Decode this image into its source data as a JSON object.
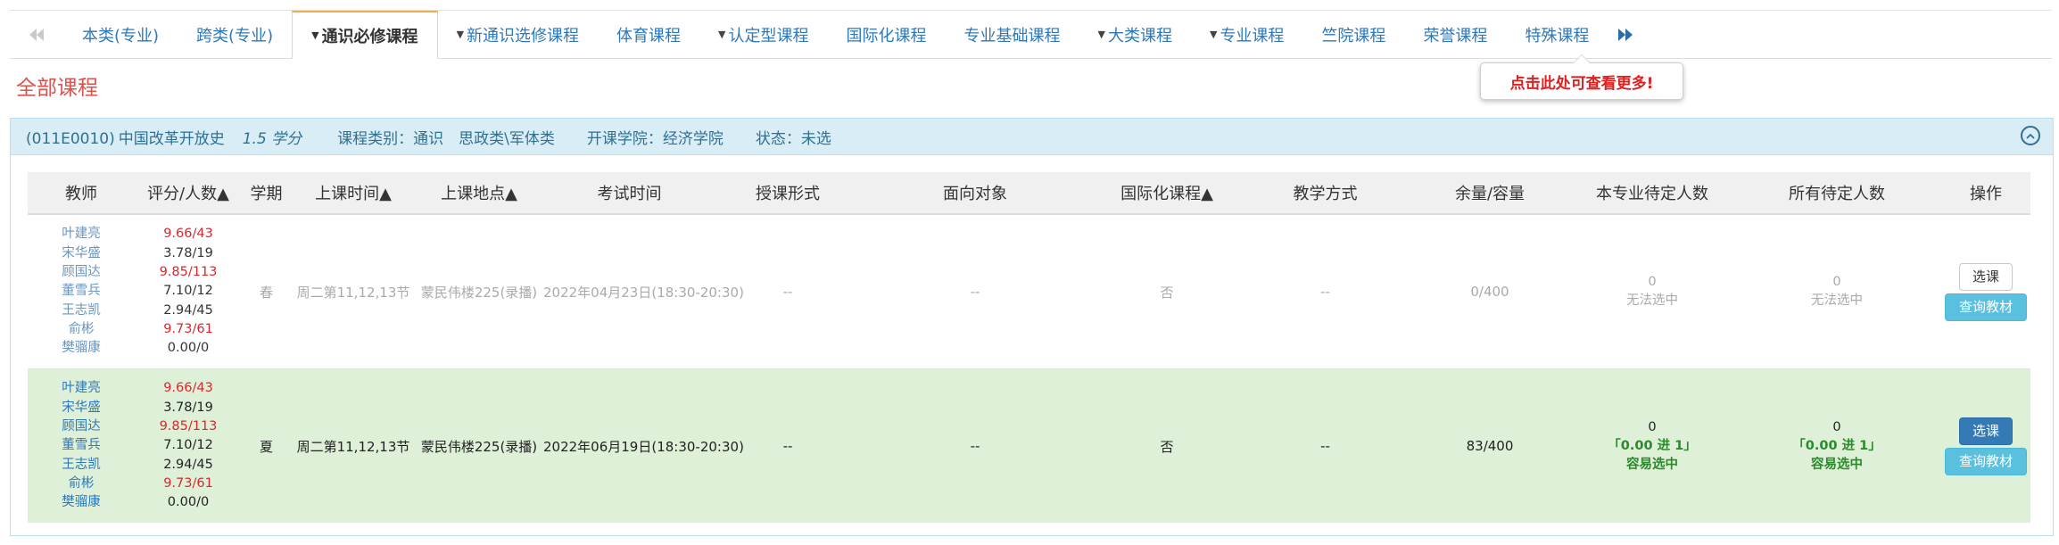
{
  "tabs": [
    {
      "label": "本类(专业)",
      "caret": false,
      "active": false
    },
    {
      "label": "跨类(专业)",
      "caret": false,
      "active": false
    },
    {
      "label": "通识必修课程",
      "caret": true,
      "active": true
    },
    {
      "label": "新通识选修课程",
      "caret": true,
      "active": false
    },
    {
      "label": "体育课程",
      "caret": false,
      "active": false
    },
    {
      "label": "认定型课程",
      "caret": true,
      "active": false
    },
    {
      "label": "国际化课程",
      "caret": false,
      "active": false
    },
    {
      "label": "专业基础课程",
      "caret": false,
      "active": false
    },
    {
      "label": "大类课程",
      "caret": true,
      "active": false
    },
    {
      "label": "专业课程",
      "caret": true,
      "active": false
    },
    {
      "label": "竺院课程",
      "caret": false,
      "active": false
    },
    {
      "label": "荣誉课程",
      "caret": false,
      "active": false
    },
    {
      "label": "特殊课程",
      "caret": false,
      "active": false
    }
  ],
  "tooltip": "点击此处可查看更多!",
  "section_title": "全部课程",
  "course": {
    "code": "(011E0010)",
    "name": "中国改革开放史",
    "credit": "1.5 学分",
    "category": "课程类别：通识　思政类\\军体类",
    "college": "开课学院：经济学院",
    "status": "状态：未选"
  },
  "columns": [
    "教师",
    "评分/人数▲",
    "学期",
    "上课时间▲",
    "上课地点▲",
    "考试时间",
    "授课形式",
    "面向对象",
    "国际化课程▲",
    "教学方式",
    "余量/容量",
    "本专业待定人数",
    "所有待定人数",
    "操作"
  ],
  "rows": [
    {
      "teachers": [
        "叶建亮",
        "宋华盛",
        "顾国达",
        "董雪兵",
        "王志凯",
        "俞彬",
        "樊骝康"
      ],
      "ratings": [
        {
          "v": "9.66/43",
          "hi": true
        },
        {
          "v": "3.78/19",
          "hi": false
        },
        {
          "v": "9.85/113",
          "hi": true
        },
        {
          "v": "7.10/12",
          "hi": false
        },
        {
          "v": "2.94/45",
          "hi": false
        },
        {
          "v": "9.73/61",
          "hi": true
        },
        {
          "v": "0.00/0",
          "hi": false
        }
      ],
      "term": "春",
      "time": "周二第11,12,13节",
      "place": "蒙民伟楼225(录播)",
      "exam": "2022年04月23日(18:30-20:30)",
      "form": "--",
      "audience": "--",
      "intl": "否",
      "method": "--",
      "capacity": "0/400",
      "major_pending": {
        "count": "0",
        "ratio": "",
        "note": "无法选中"
      },
      "all_pending": {
        "count": "0",
        "ratio": "",
        "note": "无法选中"
      },
      "select_label": "选课",
      "book_label": "查询教材"
    },
    {
      "teachers": [
        "叶建亮",
        "宋华盛",
        "顾国达",
        "董雪兵",
        "王志凯",
        "俞彬",
        "樊骝康"
      ],
      "ratings": [
        {
          "v": "9.66/43",
          "hi": true
        },
        {
          "v": "3.78/19",
          "hi": false
        },
        {
          "v": "9.85/113",
          "hi": true
        },
        {
          "v": "7.10/12",
          "hi": false
        },
        {
          "v": "2.94/45",
          "hi": false
        },
        {
          "v": "9.73/61",
          "hi": true
        },
        {
          "v": "0.00/0",
          "hi": false
        }
      ],
      "term": "夏",
      "time": "周二第11,12,13节",
      "place": "蒙民伟楼225(录播)",
      "exam": "2022年06月19日(18:30-20:30)",
      "form": "--",
      "audience": "--",
      "intl": "否",
      "method": "--",
      "capacity": "83/400",
      "major_pending": {
        "count": "0",
        "ratio": "「0.00 进 1」",
        "note": "容易选中"
      },
      "all_pending": {
        "count": "0",
        "ratio": "「0.00 进 1」",
        "note": "容易选中"
      },
      "select_label": "选课",
      "book_label": "查询教材"
    }
  ],
  "colors": {
    "accent": "#2e78b9",
    "danger": "#d9534f",
    "success_bg": "#dff0d8",
    "info": "#5bc0de",
    "panel_head": "#d9edf7"
  }
}
